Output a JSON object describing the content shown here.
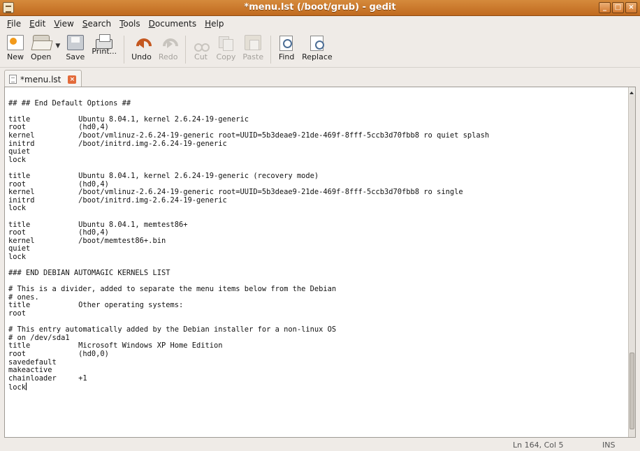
{
  "window": {
    "title": "*menu.lst (/boot/grub) - gedit",
    "controls": [
      "_",
      "□",
      "×"
    ]
  },
  "menubar": {
    "items": [
      {
        "mnemonic": "F",
        "rest": "ile"
      },
      {
        "mnemonic": "E",
        "rest": "dit"
      },
      {
        "mnemonic": "V",
        "rest": "iew"
      },
      {
        "mnemonic": "S",
        "rest": "earch"
      },
      {
        "mnemonic": "T",
        "rest": "ools"
      },
      {
        "mnemonic": "D",
        "rest": "ocuments"
      },
      {
        "mnemonic": "H",
        "rest": "elp"
      }
    ]
  },
  "toolbar": {
    "new": "New",
    "open": "Open",
    "save": "Save",
    "print": "Print...",
    "undo": "Undo",
    "redo": "Redo",
    "cut": "Cut",
    "copy": "Copy",
    "paste": "Paste",
    "find": "Find",
    "replace": "Replace"
  },
  "tab": {
    "label": "*menu.lst"
  },
  "editor": {
    "lines": [
      "",
      "## ## End Default Options ##",
      "",
      "title           Ubuntu 8.04.1, kernel 2.6.24-19-generic",
      "root            (hd0,4)",
      "kernel          /boot/vmlinuz-2.6.24-19-generic root=UUID=5b3deae9-21de-469f-8fff-5ccb3d70fbb8 ro quiet splash",
      "initrd          /boot/initrd.img-2.6.24-19-generic",
      "quiet",
      "lock",
      "",
      "title           Ubuntu 8.04.1, kernel 2.6.24-19-generic (recovery mode)",
      "root            (hd0,4)",
      "kernel          /boot/vmlinuz-2.6.24-19-generic root=UUID=5b3deae9-21de-469f-8fff-5ccb3d70fbb8 ro single",
      "initrd          /boot/initrd.img-2.6.24-19-generic",
      "lock",
      "",
      "title           Ubuntu 8.04.1, memtest86+",
      "root            (hd0,4)",
      "kernel          /boot/memtest86+.bin",
      "quiet",
      "lock",
      "",
      "### END DEBIAN AUTOMAGIC KERNELS LIST",
      "",
      "# This is a divider, added to separate the menu items below from the Debian",
      "# ones.",
      "title           Other operating systems:",
      "root",
      "",
      "# This entry automatically added by the Debian installer for a non-linux OS",
      "# on /dev/sda1",
      "title           Microsoft Windows XP Home Edition",
      "root            (hd0,0)",
      "savedefault",
      "makeactive",
      "chainloader     +1",
      "lock"
    ]
  },
  "statusbar": {
    "position": "Ln 164, Col 5",
    "mode": "INS"
  },
  "colors": {
    "titlebar": "#c06a1f",
    "tab_close": "#e36b3b"
  }
}
